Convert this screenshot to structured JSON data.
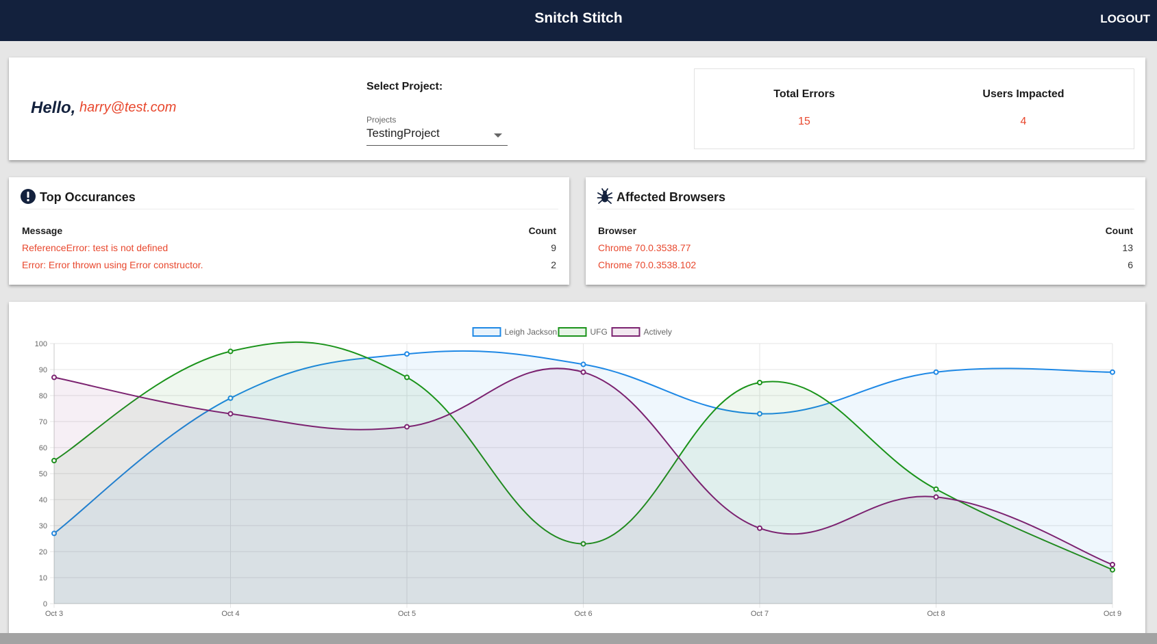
{
  "header": {
    "title": "Snitch Stitch",
    "logout_label": "LOGOUT"
  },
  "greeting": {
    "hello": "Hello,",
    "email": "harry@test.com"
  },
  "project": {
    "select_label": "Select Project:",
    "caption": "Projects",
    "selected": "TestingProject"
  },
  "stats": {
    "total_errors_label": "Total Errors",
    "total_errors_value": "15",
    "users_impacted_label": "Users Impacted",
    "users_impacted_value": "4"
  },
  "top_occurrences": {
    "title": "Top Occurances",
    "icon": "exclamation-circle-icon",
    "col_message": "Message",
    "col_count": "Count",
    "rows": [
      {
        "message": "ReferenceError: test is not defined",
        "count": "9"
      },
      {
        "message": "Error: Error thrown using Error constructor.",
        "count": "2"
      }
    ]
  },
  "affected_browsers": {
    "title": "Affected Browsers",
    "icon": "bug-icon",
    "col_browser": "Browser",
    "col_count": "Count",
    "rows": [
      {
        "browser": "Chrome 70.0.3538.77",
        "count": "13"
      },
      {
        "browser": "Chrome 70.0.3538.102",
        "count": "6"
      }
    ]
  },
  "colors": {
    "navbar": "#13213d",
    "accent": "#e8472d",
    "leigh": "#1e88e5",
    "ufg": "#1a931a",
    "actively": "#7b2270"
  },
  "chart_data": {
    "type": "line",
    "categories": [
      "Oct 3",
      "Oct 4",
      "Oct 5",
      "Oct 6",
      "Oct 7",
      "Oct 8",
      "Oct 9"
    ],
    "ylim": [
      0,
      100
    ],
    "yticks": [
      0,
      10,
      20,
      30,
      40,
      50,
      60,
      70,
      80,
      90,
      100
    ],
    "grid": true,
    "legend": "top-center",
    "filled": true,
    "series": [
      {
        "name": "Leigh Jackson",
        "color": "#1e88e5",
        "values": [
          27,
          79,
          96,
          92,
          73,
          89,
          89
        ]
      },
      {
        "name": "UFG",
        "color": "#1a931a",
        "values": [
          55,
          97,
          87,
          23,
          85,
          44,
          13
        ]
      },
      {
        "name": "Actively",
        "color": "#7b2270",
        "values": [
          87,
          73,
          68,
          89,
          29,
          41,
          15
        ]
      }
    ]
  }
}
